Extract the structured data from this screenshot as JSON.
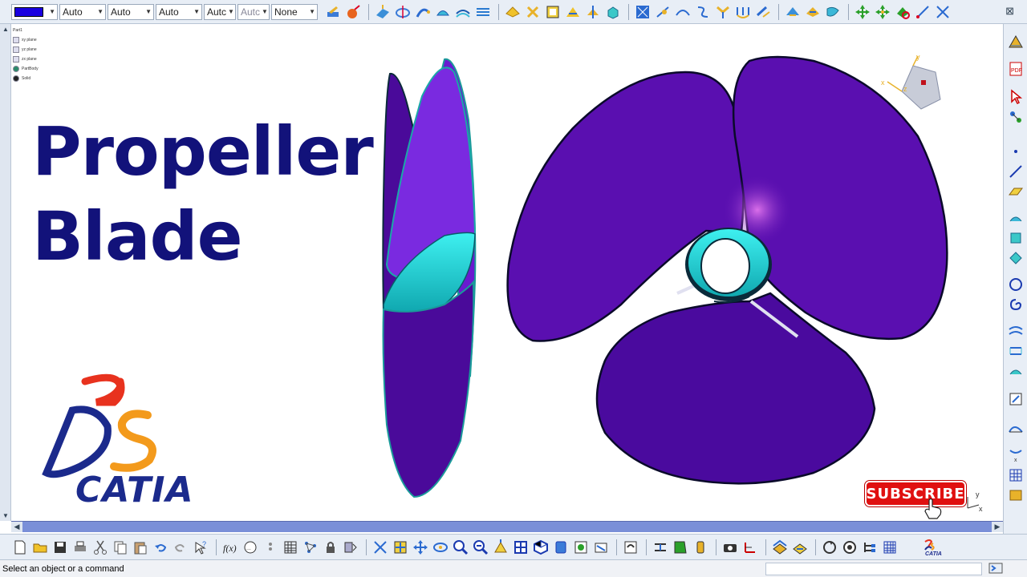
{
  "toolbar_top": {
    "color_value": "",
    "line_weight": "Auto",
    "line_type": "Auto",
    "linetype2": "Auto",
    "layer": "Autc",
    "render": "Autc",
    "filter": "None"
  },
  "tree": {
    "items": [
      "Part1",
      "xy plane",
      "yz plane",
      "zx plane",
      "PartBody",
      "Solid"
    ]
  },
  "title": {
    "line1": "Propeller",
    "line2": "Blade"
  },
  "logo": {
    "wordmark": "CATIA",
    "brand_color_red": "#e8321e",
    "brand_color_orange": "#f39a1c",
    "brand_color_blue": "#1b2a8c"
  },
  "compass": {
    "x_label": "x",
    "y_label": "y",
    "z_label": "z"
  },
  "subscribe": {
    "label": "SUBSCRIBE"
  },
  "mini_axis": {
    "y_label": "y",
    "x_label": "x"
  },
  "statusbar": {
    "message": "Select an object or a command"
  },
  "colors": {
    "blade": "#5a0fb0",
    "hub": "#1ae0e0",
    "toolbar_bg": "#e8eef6",
    "title_text": "#12127a"
  }
}
